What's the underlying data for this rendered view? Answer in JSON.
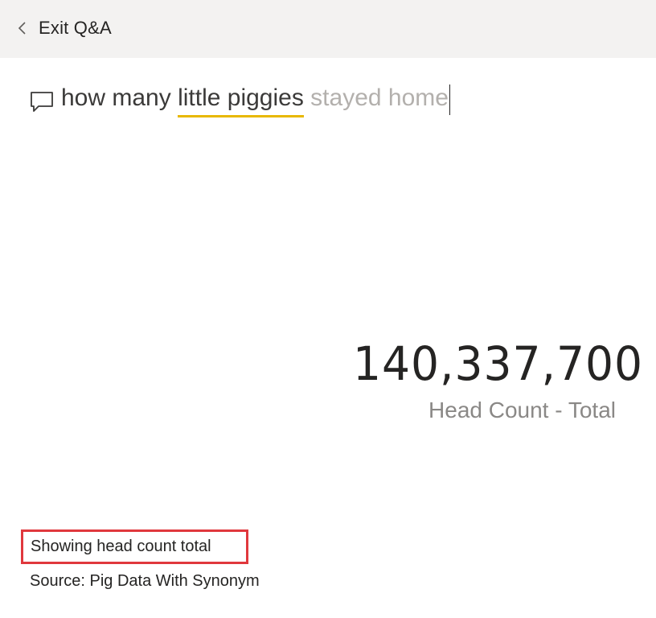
{
  "header": {
    "exit_label": "Exit Q&A"
  },
  "question": {
    "prefix": "how many ",
    "term": "little piggies",
    "suggestion": " stayed home"
  },
  "card": {
    "value": "140,337,700",
    "label": "Head Count - Total"
  },
  "footer": {
    "showing": "Showing head count total",
    "source": "Source: Pig Data With Synonym"
  },
  "colors": {
    "topbar": "#f3f2f1",
    "term_underline": "#e8b800",
    "highlight_box": "#e0383d"
  },
  "icons": [
    "chevron-left-icon",
    "chat-bubble-icon"
  ]
}
